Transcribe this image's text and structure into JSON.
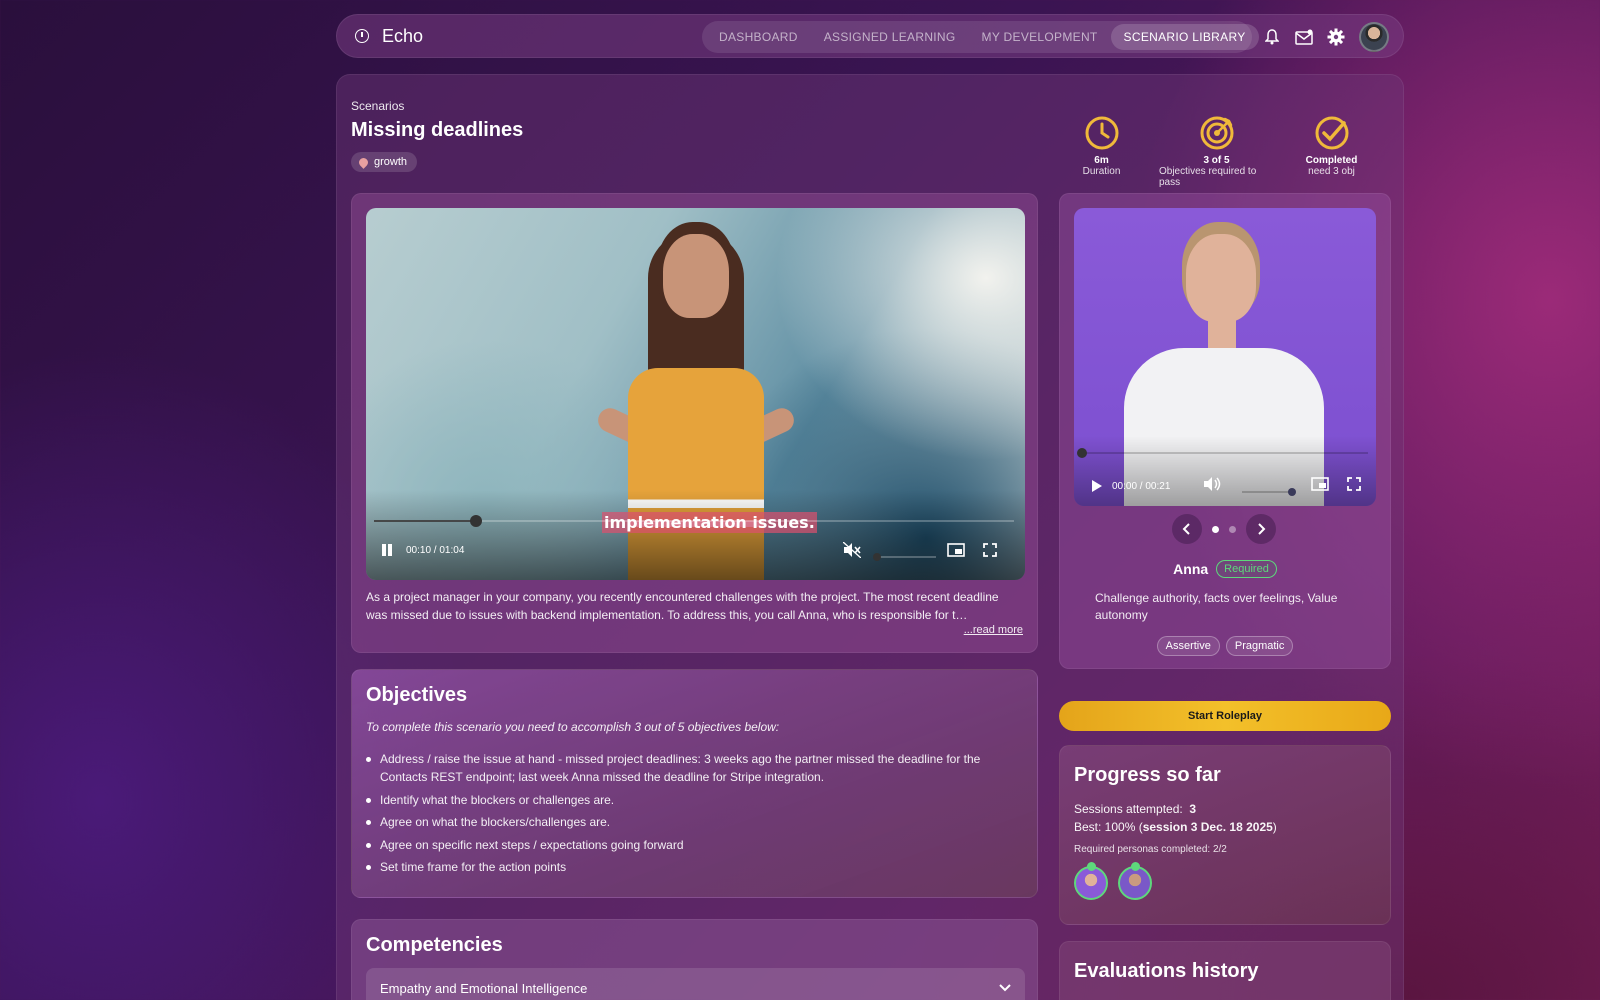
{
  "app": {
    "name": "Echo"
  },
  "nav": {
    "tabs": [
      {
        "label": "DASHBOARD"
      },
      {
        "label": "ASSIGNED LEARNING"
      },
      {
        "label": "MY DEVELOPMENT"
      },
      {
        "label": "SCENARIO LIBRARY",
        "active": true
      }
    ],
    "icons": [
      "bell-icon",
      "mail-icon",
      "gear-icon",
      "avatar"
    ]
  },
  "header": {
    "breadcrumb": "Scenarios",
    "title": "Missing deadlines",
    "tag": "growth"
  },
  "stats": [
    {
      "icon": "clock-icon",
      "value": "6m",
      "label": "Duration"
    },
    {
      "icon": "target-icon",
      "value": "3 of 5",
      "label": "Objectives required to pass"
    },
    {
      "icon": "check-circle-icon",
      "value": "Completed",
      "label": "need 3 obj"
    }
  ],
  "video": {
    "caption": "implementation issues.",
    "time": "00:10 / 01:04",
    "progress": 0.16,
    "muted": true,
    "description_line1": "As a project manager in your company, you recently encountered challenges with the project. The most recent deadline",
    "description_line2": "was missed due to issues with backend implementation. To address this, you call Anna, who is responsible for t…",
    "read_more": "...read more"
  },
  "persona": {
    "time": "00:00 / 00:21",
    "progress": 0,
    "name": "Anna",
    "badge": "Required",
    "description": "Challenge authority, facts over feelings, Value autonomy",
    "traits": [
      "Assertive",
      "Pragmatic"
    ],
    "carousel": {
      "count": 2,
      "active": 0
    }
  },
  "start_button": "Start Roleplay",
  "objectives": {
    "title": "Objectives",
    "intro": "To complete this scenario you need to accomplish 3 out of 5 objectives below:",
    "items": [
      "Address / raise the issue at hand - missed project deadlines: 3 weeks ago the partner missed the deadline for the Contacts REST endpoint; last week Anna missed the deadline for Stripe integration.",
      "Identify what the blockers or challenges are.",
      "Agree on what the blockers/challenges are.",
      "Agree on specific next steps / expectations going forward",
      "Set time frame for the action points"
    ]
  },
  "competencies": {
    "title": "Competencies",
    "items": [
      "Empathy and Emotional Intelligence"
    ]
  },
  "progress": {
    "title": "Progress so far",
    "sessions_label": "Sessions attempted:",
    "sessions_value": "3",
    "best_label": "Best: 100% (",
    "best_value": "session 3 Dec. 18 2025",
    "best_suffix": ")",
    "required_personas": "Required personas completed: 2/2"
  },
  "evaluations": {
    "title": "Evaluations history"
  },
  "colors": {
    "accent": "#f3c02a",
    "required_green": "#5ed87c",
    "caption_bg": "#dc506e"
  }
}
